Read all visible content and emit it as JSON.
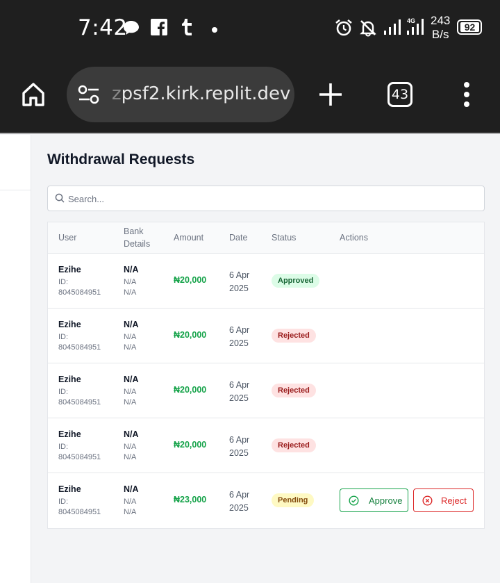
{
  "status_bar": {
    "time": "7:42",
    "net_speed_value": "243",
    "net_speed_unit": "B/s",
    "battery": "92",
    "icons": [
      "chat-bubble-icon",
      "facebook-icon",
      "tumblr-icon",
      "dot-icon",
      "alarm-icon",
      "bell-off-icon",
      "signal-icon",
      "signal-4g-icon"
    ]
  },
  "browser": {
    "url_faded": "z",
    "url": "psf2.kirk.replit.dev",
    "tab_count": "43",
    "icons": [
      "home-icon",
      "site-settings-icon",
      "plus-icon",
      "menu-dots-icon"
    ]
  },
  "page": {
    "title": "Withdrawal Requests",
    "search_placeholder": "Search..."
  },
  "table": {
    "headers": {
      "user": "User",
      "bank_details_1": "Bank",
      "bank_details_2": "Details",
      "amount": "Amount",
      "date": "Date",
      "status": "Status",
      "actions": "Actions"
    },
    "rows": [
      {
        "name": "Ezihe",
        "id_label": "ID:",
        "id": "8045084951",
        "bank": "N/A",
        "bank_sub1": "N/A",
        "bank_sub2": "N/A",
        "amount": "₦20,000",
        "date_1": "6 Apr",
        "date_2": "2025",
        "status": "Approved"
      },
      {
        "name": "Ezihe",
        "id_label": "ID:",
        "id": "8045084951",
        "bank": "N/A",
        "bank_sub1": "N/A",
        "bank_sub2": "N/A",
        "amount": "₦20,000",
        "date_1": "6 Apr",
        "date_2": "2025",
        "status": "Rejected"
      },
      {
        "name": "Ezihe",
        "id_label": "ID:",
        "id": "8045084951",
        "bank": "N/A",
        "bank_sub1": "N/A",
        "bank_sub2": "N/A",
        "amount": "₦20,000",
        "date_1": "6 Apr",
        "date_2": "2025",
        "status": "Rejected"
      },
      {
        "name": "Ezihe",
        "id_label": "ID:",
        "id": "8045084951",
        "bank": "N/A",
        "bank_sub1": "N/A",
        "bank_sub2": "N/A",
        "amount": "₦20,000",
        "date_1": "6 Apr",
        "date_2": "2025",
        "status": "Rejected"
      },
      {
        "name": "Ezihe",
        "id_label": "ID:",
        "id": "8045084951",
        "bank": "N/A",
        "bank_sub1": "N/A",
        "bank_sub2": "N/A",
        "amount": "₦23,000",
        "date_1": "6 Apr",
        "date_2": "2025",
        "status": "Pending",
        "approve_label": "Approve",
        "reject_label": "Reject"
      }
    ]
  },
  "colors": {
    "amount": "#16a34a",
    "approved_bg": "#dcfce7",
    "rejected_bg": "#fee2e2",
    "pending_bg": "#fef9c3",
    "approve_button": "#16a34a",
    "reject_button": "#dc2626"
  }
}
